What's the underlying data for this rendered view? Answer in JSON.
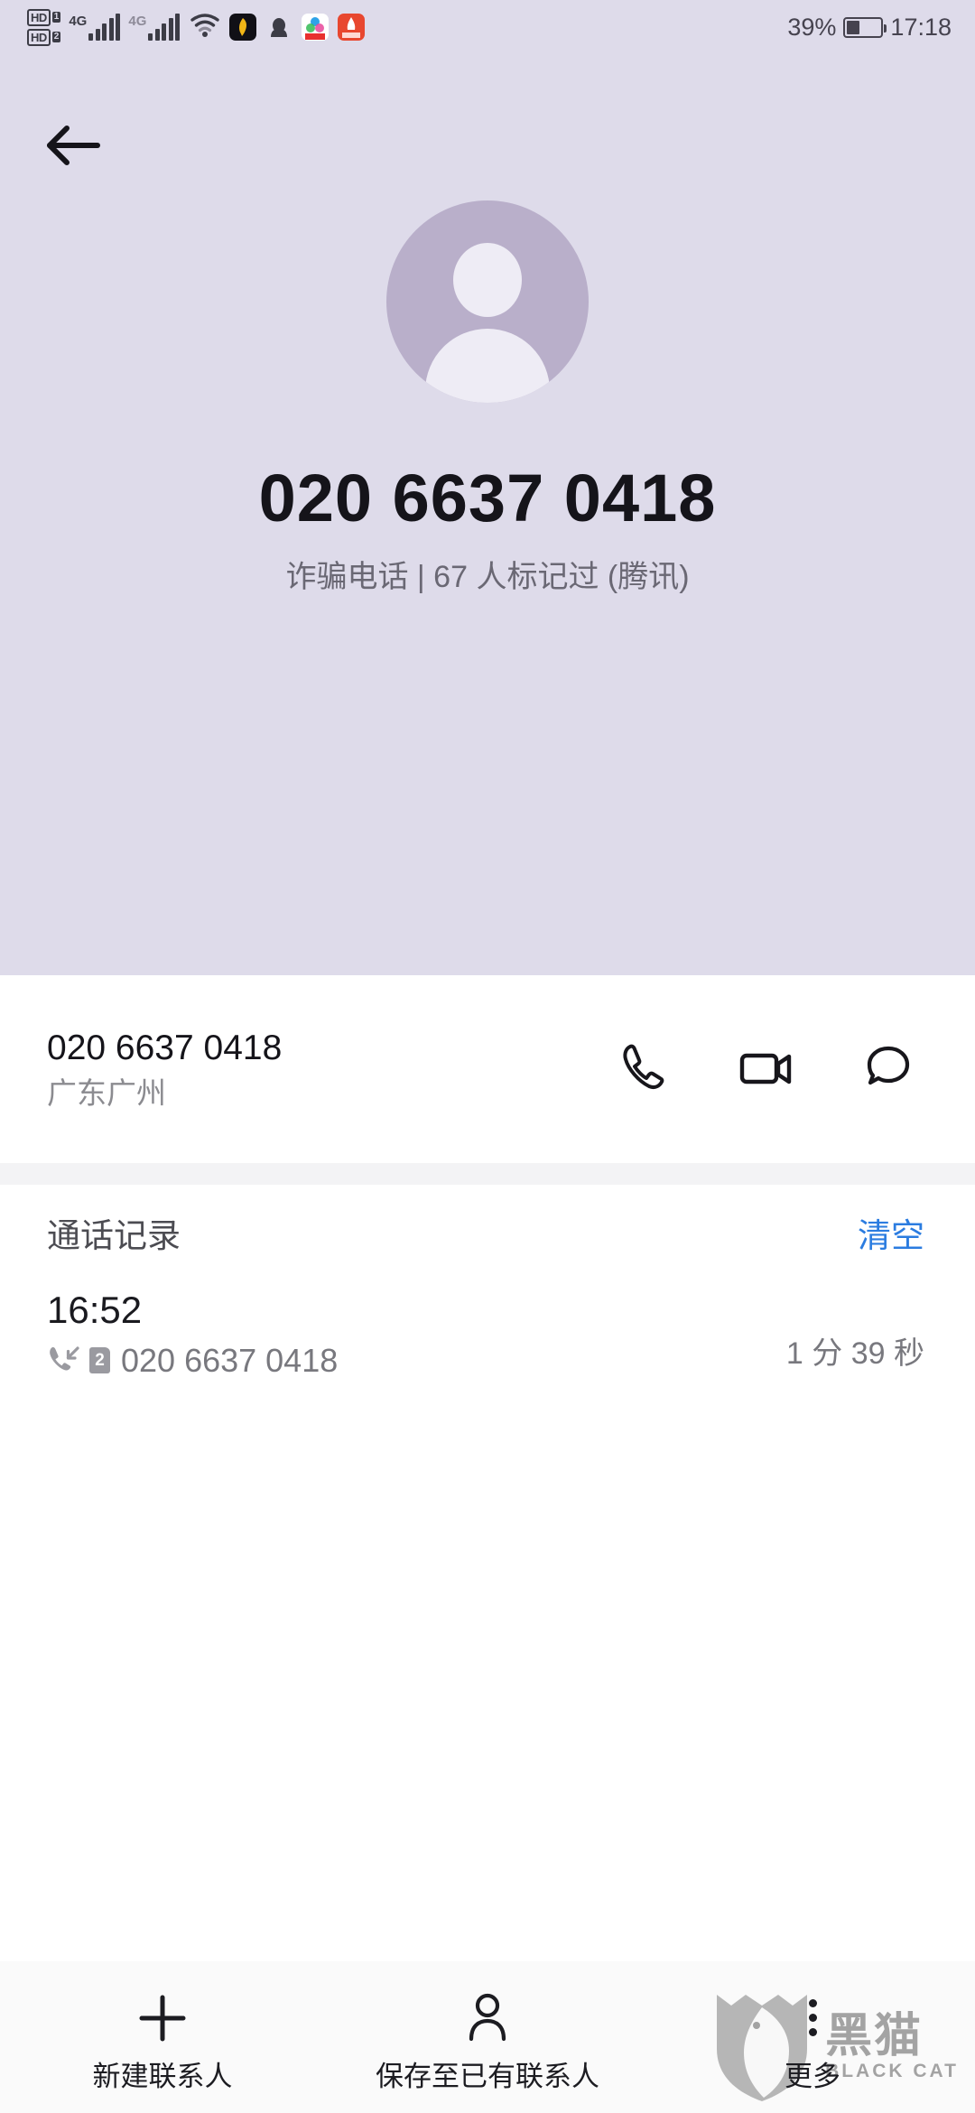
{
  "status_bar": {
    "hd_badges": [
      {
        "label": "HD",
        "sim": "1"
      },
      {
        "label": "HD",
        "sim": "2"
      }
    ],
    "networks": [
      {
        "label": "4G",
        "icon": "signal-bars-icon"
      },
      {
        "label": "4G",
        "icon": "signal-bars-icon"
      }
    ],
    "wifi_icon": "wifi-icon",
    "app_icons": [
      "app-icon-black",
      "app-icon-qq-penguin",
      "app-icon-multicolor",
      "app-icon-huawei-red"
    ],
    "battery_percent": "39%",
    "battery_level": 39,
    "time": "17:18"
  },
  "header": {
    "back_icon": "arrow-left-icon",
    "avatar_icon": "default-contact-avatar",
    "phone_number": "020 6637 0418",
    "tag_line": "诈骗电话 | 67 人标记过 (腾讯)",
    "background_color": "#dedbea",
    "avatar_color": "#b9afca"
  },
  "contact": {
    "number": "020 6637 0418",
    "location": "广东广州",
    "actions": [
      {
        "name": "call",
        "icon": "phone-icon"
      },
      {
        "name": "video-call",
        "icon": "video-camera-icon"
      },
      {
        "name": "message",
        "icon": "message-bubble-icon"
      }
    ]
  },
  "call_log": {
    "title": "通话记录",
    "clear_label": "清空",
    "clear_color": "#2b7ce0",
    "entries": [
      {
        "time": "16:52",
        "type_icon": "incoming-call-icon",
        "sim": "2",
        "number": "020 6637 0418",
        "duration": "1 分 39 秒"
      }
    ]
  },
  "bottom_bar": {
    "items": [
      {
        "label": "新建联系人",
        "icon": "plus-icon"
      },
      {
        "label": "保存至已有联系人",
        "icon": "person-icon"
      },
      {
        "label": "更多",
        "icon": "more-dots-icon"
      }
    ]
  },
  "watermark": {
    "cn": "黑猫",
    "en": "BLACK CAT",
    "logo_icon": "black-cat-shield-logo"
  }
}
